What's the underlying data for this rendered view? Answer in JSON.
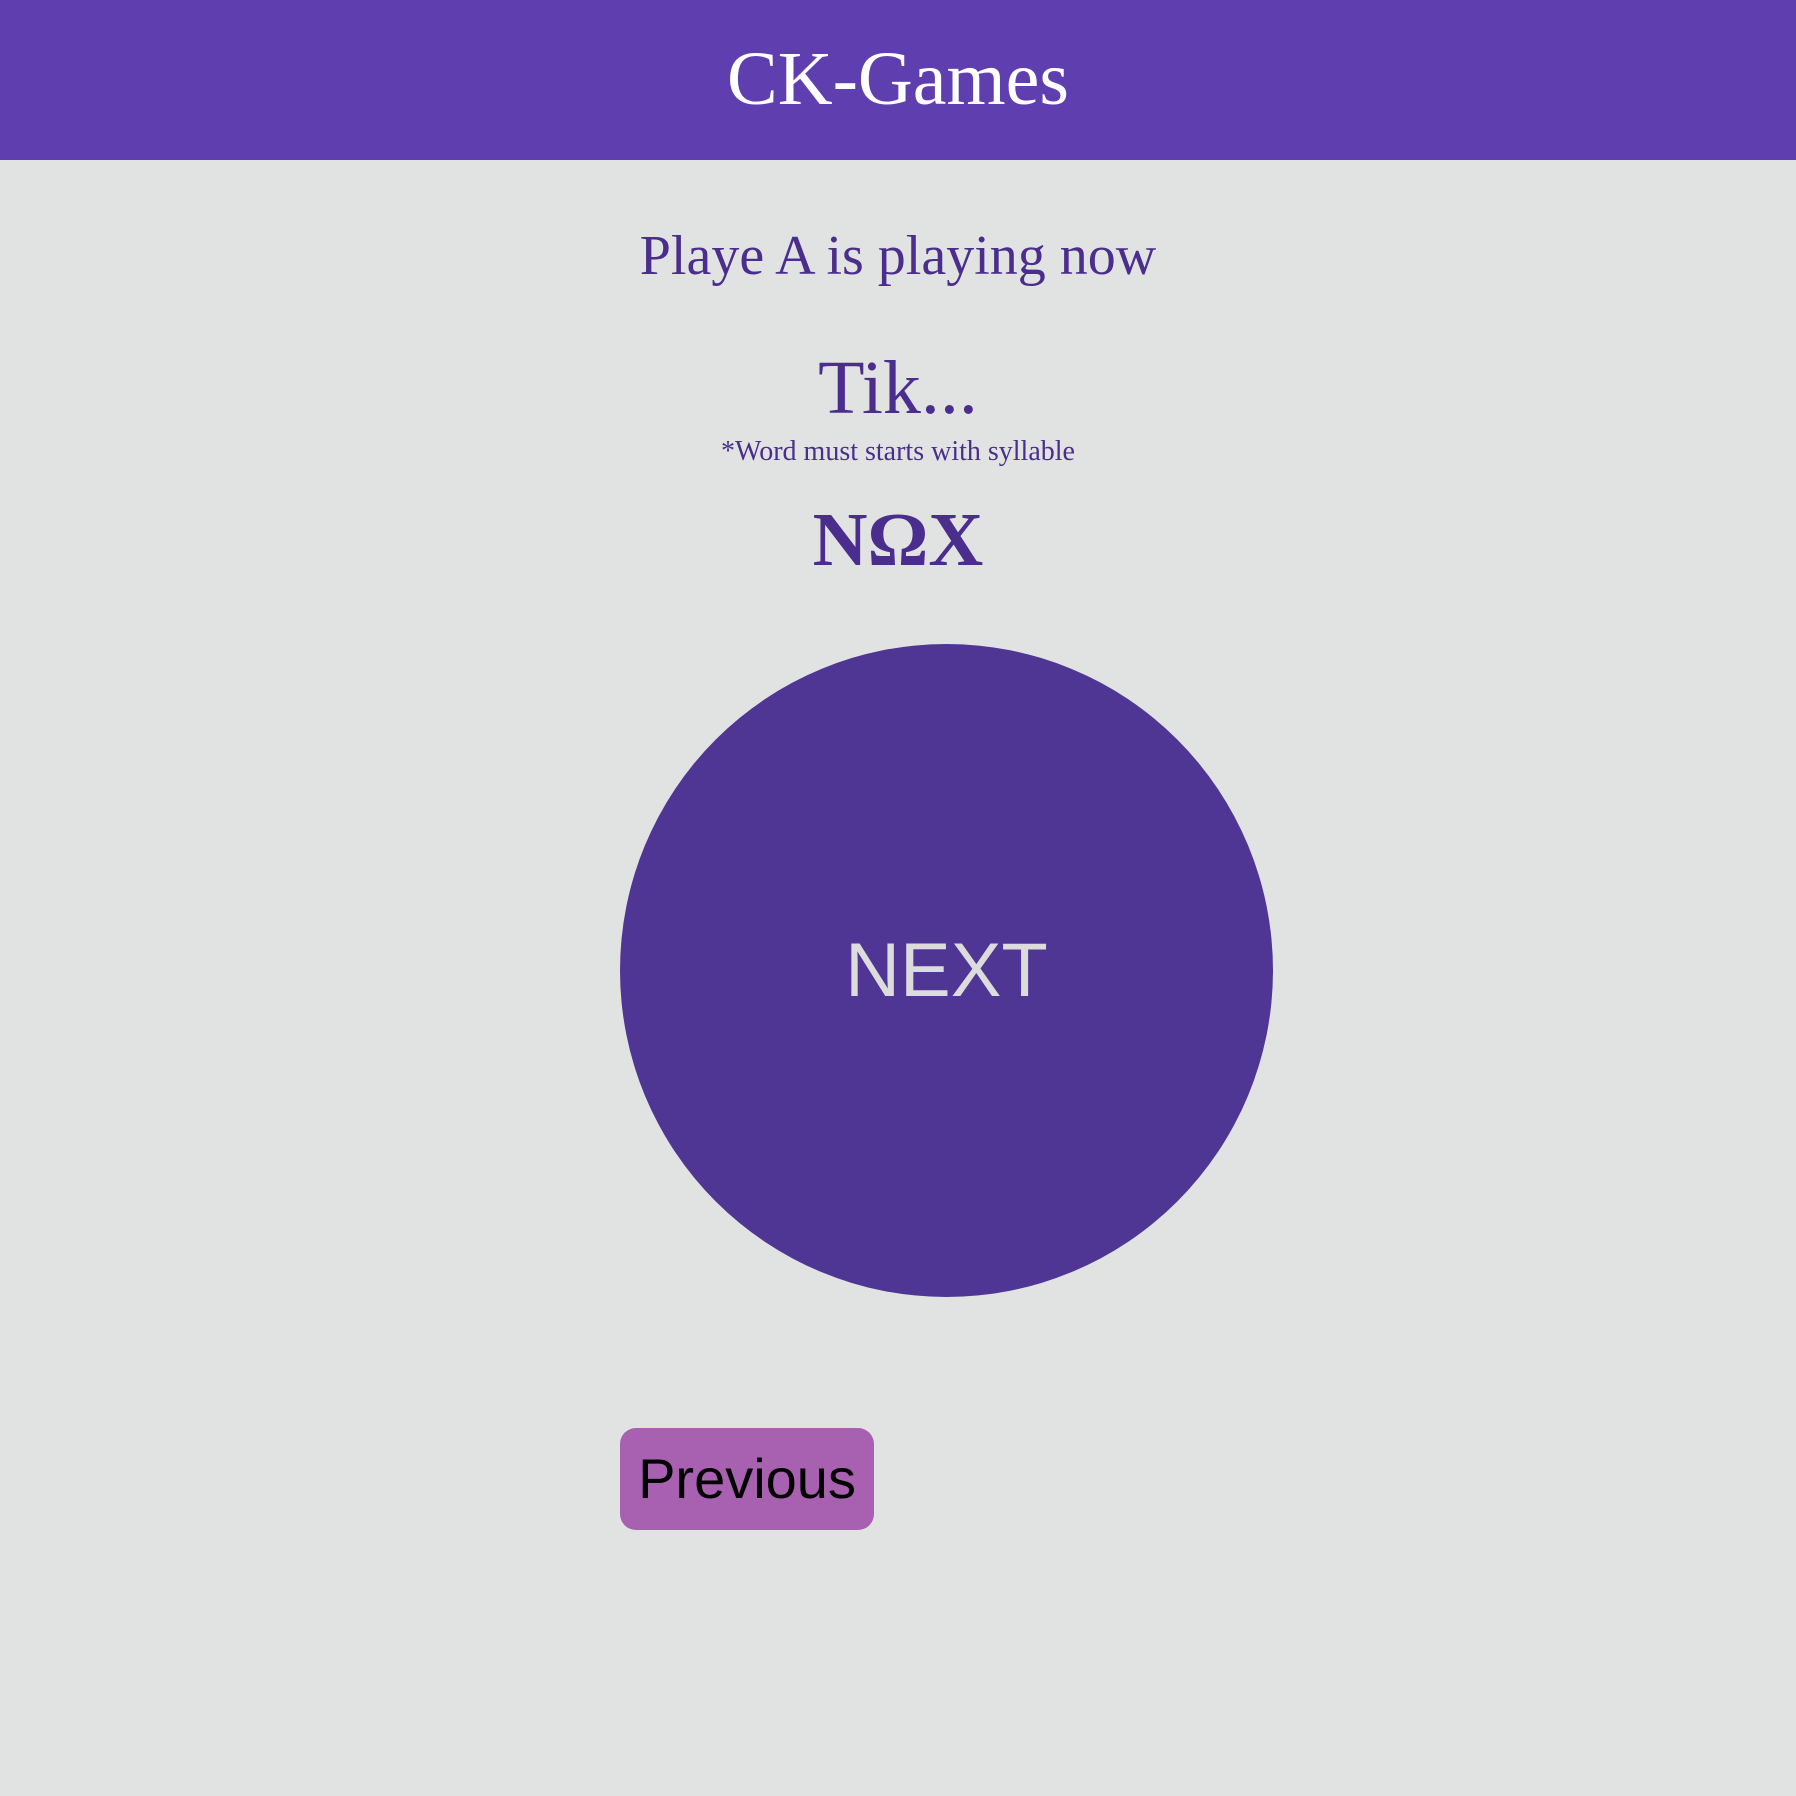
{
  "header": {
    "title": "CK-Games"
  },
  "game": {
    "status": "Playe A is playing now",
    "syllable": "Tik...",
    "hint": "*Word must starts with syllable",
    "code": "NΩX"
  },
  "controls": {
    "next_label": "NEXT",
    "previous_label": "Previous"
  },
  "colors": {
    "header_bg": "#5f3fb0",
    "page_bg": "#e1e3e3",
    "text_purple": "#4a2d8c",
    "next_bg": "#4f3594",
    "previous_bg": "#a860b0"
  }
}
